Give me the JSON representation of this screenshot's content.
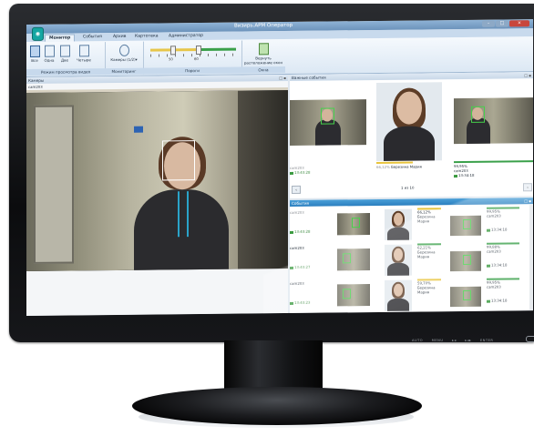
{
  "window": {
    "title": "Визирь.АРМ Оператор",
    "controls": [
      "–",
      "□",
      "×"
    ]
  },
  "ribbon": {
    "tabs": [
      "Монитор",
      "События",
      "Архив",
      "Картотека",
      "Администратор"
    ],
    "active_tab": 0,
    "groups": [
      {
        "label": "Режим просмотра видео",
        "buttons": [
          "Все",
          "Одна",
          "Две",
          "Четыре"
        ]
      },
      {
        "label": "Мониторинг",
        "buttons": [
          "Камеры (1/2)▾"
        ]
      },
      {
        "label": "Пороги",
        "ticks": [
          "50",
          "60"
        ]
      },
      {
        "label": "Окна",
        "buttons": [
          "Вернуть расположение окон"
        ]
      }
    ]
  },
  "cameras_panel": {
    "header": "Камеры",
    "camera_name": "cam203"
  },
  "important_events": {
    "header": "Важные события",
    "match": {
      "camera": "cam203",
      "time": "13:43:28",
      "score": "66,12%",
      "person": "Березина Мария",
      "right_score": "99,95%",
      "right_camera": "cam203",
      "right_time": "13:34:18"
    },
    "pager": "1 из 10"
  },
  "events_panel": {
    "header": "События",
    "rows": [
      {
        "camera": "cam203",
        "time": "13:43:28",
        "score": "66,12%",
        "name1": "Березина",
        "name2": "Мария",
        "r_score": "99,95%",
        "r_camera": "cam203",
        "r_time": "13:34:18"
      },
      {
        "camera": "cam203",
        "time": "13:43:27",
        "score": "62,21%",
        "name1": "Березина",
        "name2": "Мария",
        "r_score": "99,88%",
        "r_camera": "cam203",
        "r_time": "13:34:18"
      },
      {
        "camera": "cam203",
        "time": "13:43:23",
        "score": "59,70%",
        "name1": "Березина",
        "name2": "Мария",
        "r_score": "99,95%",
        "r_camera": "cam203",
        "r_time": "13:34:18"
      }
    ]
  },
  "monitor_buttons": [
    "AUTO",
    "MENU",
    "▸◂",
    "▸◂▸",
    "ENTER",
    "⏻"
  ]
}
